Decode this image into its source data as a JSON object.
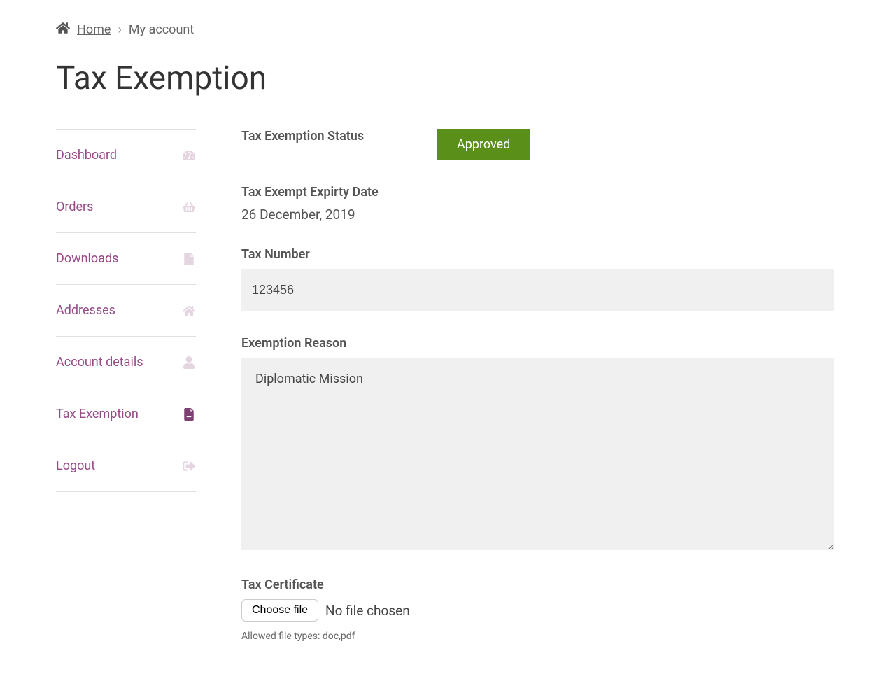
{
  "breadcrumb": {
    "home": "Home",
    "current": "My account"
  },
  "page_title": "Tax Exemption",
  "sidebar": {
    "items": [
      {
        "label": "Dashboard"
      },
      {
        "label": "Orders"
      },
      {
        "label": "Downloads"
      },
      {
        "label": "Addresses"
      },
      {
        "label": "Account details"
      },
      {
        "label": "Tax Exemption"
      },
      {
        "label": "Logout"
      }
    ]
  },
  "form": {
    "status_label": "Tax Exemption Status",
    "status_value": "Approved",
    "expiry_label": "Tax Exempt Expirty Date",
    "expiry_value": "26 December, 2019",
    "tax_number_label": "Tax Number",
    "tax_number_value": "123456",
    "reason_label": "Exemption Reason",
    "reason_value": "Diplomatic Mission",
    "cert_label": "Tax Certificate",
    "choose_file_label": "Choose file",
    "no_file_text": "No file chosen",
    "allowed_types": "Allowed file types: doc,pdf"
  }
}
